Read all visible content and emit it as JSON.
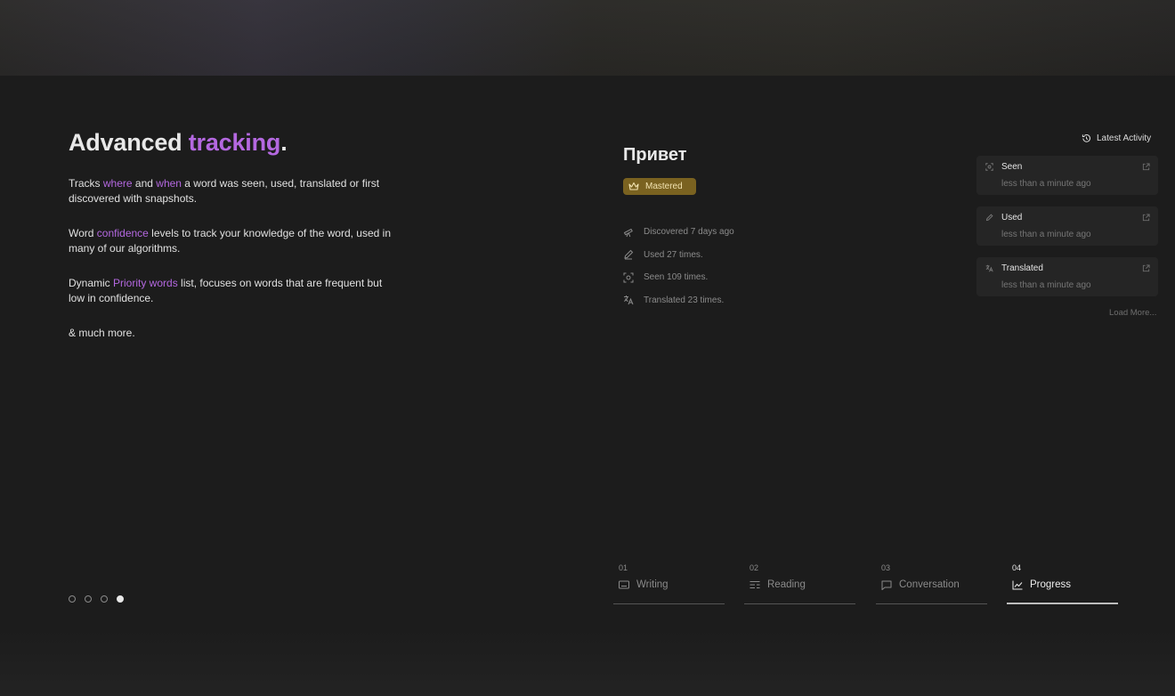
{
  "feature": {
    "headline_prefix": "Advanced ",
    "headline_accent": "tracking",
    "headline_suffix": ".",
    "paragraphs": [
      [
        "Tracks ",
        "where",
        " and ",
        "when",
        " a word was seen, used, translated or first discovered with snapshots."
      ],
      [
        "Word ",
        "confidence",
        " levels to track your knowledge of the word, used in many of our algorithms."
      ],
      [
        "Dynamic ",
        "Priority words",
        " list, focuses on words that are frequent but low in confidence."
      ],
      [
        "& much more."
      ]
    ]
  },
  "carousel": {
    "count": 4,
    "active_index": 3
  },
  "word_card": {
    "word": "Привет",
    "badge": "Mastered",
    "badge_icon": "crown-icon",
    "stats": [
      {
        "icon": "telescope-icon",
        "text": "Discovered 7 days ago"
      },
      {
        "icon": "pencil-icon",
        "text": "Used 27 times."
      },
      {
        "icon": "eye-focus-icon",
        "text": "Seen 109 times."
      },
      {
        "icon": "translate-icon",
        "text": "Translated 23 times."
      }
    ]
  },
  "activity": {
    "header": "Latest Activity",
    "items": [
      {
        "title": "Seen",
        "time": "less than a minute ago",
        "icon": "eye-focus-icon"
      },
      {
        "title": "Used",
        "time": "less than a minute ago",
        "icon": "pencil-icon"
      },
      {
        "title": "Translated",
        "time": "less than a minute ago",
        "icon": "translate-icon"
      }
    ],
    "load_more": "Load More..."
  },
  "tabs": [
    {
      "num": "01",
      "label": "Writing",
      "icon": "keyboard-icon"
    },
    {
      "num": "02",
      "label": "Reading",
      "icon": "text-lines-icon"
    },
    {
      "num": "03",
      "label": "Conversation",
      "icon": "chat-icon"
    },
    {
      "num": "04",
      "label": "Progress",
      "icon": "chart-icon",
      "active": true
    }
  ],
  "colors": {
    "accent": "#b468e0",
    "badge_bg": "#7a6220",
    "background": "#1c1c1c"
  }
}
